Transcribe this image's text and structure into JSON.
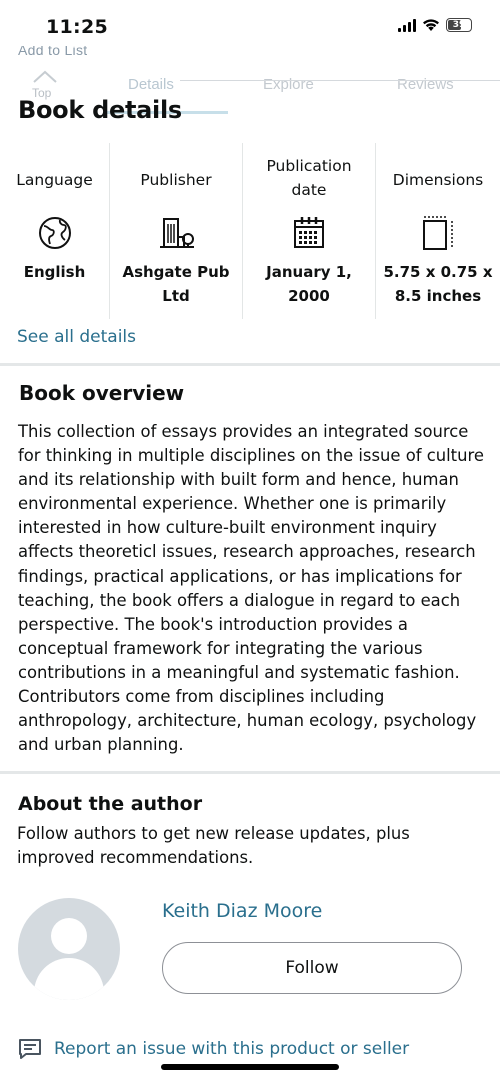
{
  "status_bar": {
    "time": "11:25",
    "battery_level": "39",
    "icons": [
      "signal-icon",
      "wifi-icon",
      "battery-icon"
    ]
  },
  "header": {
    "faded_text": "Add to List",
    "top_label": "Top",
    "tabs": [
      {
        "label": "Details"
      },
      {
        "label": "Explore"
      },
      {
        "label": "Reviews"
      }
    ]
  },
  "book_details": {
    "title": "Book details",
    "columns": [
      {
        "label_lines": [
          "Language"
        ],
        "icon": "globe-icon",
        "value_lines": [
          "English"
        ]
      },
      {
        "label_lines": [
          "Publisher"
        ],
        "icon": "building-icon",
        "value_lines": [
          "Ashgate Pub",
          "Ltd"
        ]
      },
      {
        "label_lines": [
          "Publication",
          "date"
        ],
        "icon": "calendar-icon",
        "value_lines": [
          "January 1,",
          "2000"
        ]
      },
      {
        "label_lines": [
          "Dimensions"
        ],
        "icon": "ruler-icon",
        "value_lines": [
          "5.75 x 0.75 x",
          "8.5 inches"
        ]
      }
    ],
    "see_all_label": "See all details"
  },
  "overview": {
    "title": "Book overview",
    "text": "This collection of essays provides an integrated source for thinking in multiple disciplines on the issue of culture and its relationship with built form and hence, human environmental experience. Whether one is primarily interested in how culture-built environment inquiry affects theoreticl issues, research approaches, research findings, practical applications, or has implications for teaching, the book offers a dialogue in regard to each perspective. The book's introduction provides a conceptual framework for integrating the various contributions in a meaningful and systematic fashion. Contributors come from disciplines including anthropology, architecture, human ecology, psychology and urban planning."
  },
  "author": {
    "title": "About the author",
    "subtitle": "Follow authors to get new release updates, plus improved recommendations.",
    "name": "Keith Diaz Moore",
    "follow_label": "Follow"
  },
  "report": {
    "label": "Report an issue with this product or seller"
  },
  "colors": {
    "link": "#2a6f8d",
    "text": "#0f1111",
    "divider": "#e4e7e8",
    "avatar_bg": "#d4dadf"
  }
}
